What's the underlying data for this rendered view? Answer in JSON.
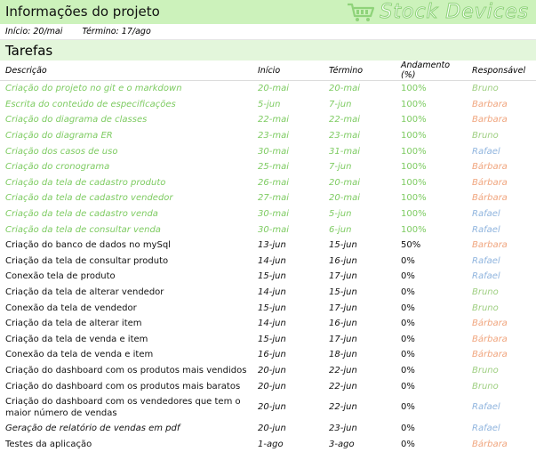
{
  "header": {
    "title": "Informações do projeto",
    "brand": "Stock Devices",
    "brand_color": "#8fd37a",
    "logo_icon": "shopping-cart-icon"
  },
  "project": {
    "start_label": "Início:",
    "start_value": "20/mai",
    "end_label": "Término:",
    "end_value": "17/ago"
  },
  "section": {
    "title": "Tarefas"
  },
  "table": {
    "columns": [
      "Descrição",
      "Início",
      "Término",
      "Andamento (%)",
      "Responsável"
    ],
    "rows": [
      {
        "desc": "Criação do projeto no git e o markdown",
        "start": "20-mai",
        "end": "20-mai",
        "progress": "100%",
        "owner": "Bruno",
        "status": "done"
      },
      {
        "desc": "Escrita do conteúdo de especificações",
        "start": "5-jun",
        "end": "7-jun",
        "progress": "100%",
        "owner": "Barbara",
        "status": "done"
      },
      {
        "desc": "Criação do diagrama de classes",
        "start": "22-mai",
        "end": "22-mai",
        "progress": "100%",
        "owner": "Barbara",
        "status": "done"
      },
      {
        "desc": "Criação do diagrama ER",
        "start": "23-mai",
        "end": "23-mai",
        "progress": "100%",
        "owner": "Bruno",
        "status": "done"
      },
      {
        "desc": "Criação dos casos de uso",
        "start": "30-mai",
        "end": "31-mai",
        "progress": "100%",
        "owner": "Rafael",
        "status": "done"
      },
      {
        "desc": "Criação do cronograma",
        "start": "25-mai",
        "end": "7-jun",
        "progress": "100%",
        "owner": "Bárbara",
        "status": "done"
      },
      {
        "desc": "Criação da tela de cadastro produto",
        "start": "26-mai",
        "end": "20-mai",
        "progress": "100%",
        "owner": "Bárbara",
        "status": "done"
      },
      {
        "desc": "Criação da tela de cadastro vendedor",
        "start": "27-mai",
        "end": "20-mai",
        "progress": "100%",
        "owner": "Bárbara",
        "status": "done"
      },
      {
        "desc": "Criação da tela de cadastro venda",
        "start": "30-mai",
        "end": "5-jun",
        "progress": "100%",
        "owner": "Rafael",
        "status": "done"
      },
      {
        "desc": "Criação da tela de consultar venda",
        "start": "30-mai",
        "end": "6-jun",
        "progress": "100%",
        "owner": "Rafael",
        "status": "done"
      },
      {
        "desc": "Criação do banco de dados no mySql",
        "start": "13-jun",
        "end": "15-jun",
        "progress": "50%",
        "owner": "Barbara",
        "status": "pending"
      },
      {
        "desc": "Criação da tela de consultar produto",
        "start": "14-jun",
        "end": "16-jun",
        "progress": "0%",
        "owner": "Rafael",
        "status": "pending"
      },
      {
        "desc": "Conexão tela de produto",
        "start": "15-jun",
        "end": "17-jun",
        "progress": "0%",
        "owner": "Rafael",
        "status": "pending"
      },
      {
        "desc": "Criação da tela de alterar vendedor",
        "start": "14-jun",
        "end": "15-jun",
        "progress": "0%",
        "owner": "Bruno",
        "status": "pending"
      },
      {
        "desc": "Conexão da tela de vendedor",
        "start": "15-jun",
        "end": "17-jun",
        "progress": "0%",
        "owner": "Bruno",
        "status": "pending"
      },
      {
        "desc": "Criação da tela de alterar item",
        "start": "14-jun",
        "end": "16-jun",
        "progress": "0%",
        "owner": "Bárbara",
        "status": "pending"
      },
      {
        "desc": "Criação da tela de venda e item",
        "start": "15-jun",
        "end": "17-jun",
        "progress": "0%",
        "owner": "Bárbara",
        "status": "pending"
      },
      {
        "desc": "Conexão da tela de venda e item",
        "start": "16-jun",
        "end": "18-jun",
        "progress": "0%",
        "owner": "Bárbara",
        "status": "pending"
      },
      {
        "desc": "Criação do dashboard com os produtos mais vendidos",
        "start": "20-jun",
        "end": "22-jun",
        "progress": "0%",
        "owner": "Bruno",
        "status": "pending"
      },
      {
        "desc": "Criação do dashboard com os produtos mais baratos",
        "start": "20-jun",
        "end": "22-jun",
        "progress": "0%",
        "owner": "Bruno",
        "status": "pending"
      },
      {
        "desc": "Criação do dashboard com os vendedores que tem o maior número de vendas",
        "start": "20-jun",
        "end": "22-jun",
        "progress": "0%",
        "owner": "Rafael",
        "status": "pending"
      },
      {
        "desc": "Geração de relatório de vendas em pdf",
        "start": "20-jun",
        "end": "23-jun",
        "progress": "0%",
        "owner": "Rafael",
        "status": "pending",
        "desc_italic": true
      },
      {
        "desc": "Testes da aplicação",
        "start": "1-ago",
        "end": "3-ago",
        "progress": "0%",
        "owner": "Bárbara",
        "status": "pending"
      }
    ]
  },
  "colors": {
    "done_text": "#7dcb61",
    "header_bg": "#ccf2bb",
    "section_bg": "#e3f6db",
    "owner_bruno": "#9fcf82",
    "owner_rafael": "#8fb4de",
    "owner_barbara": "#f0a57e"
  }
}
